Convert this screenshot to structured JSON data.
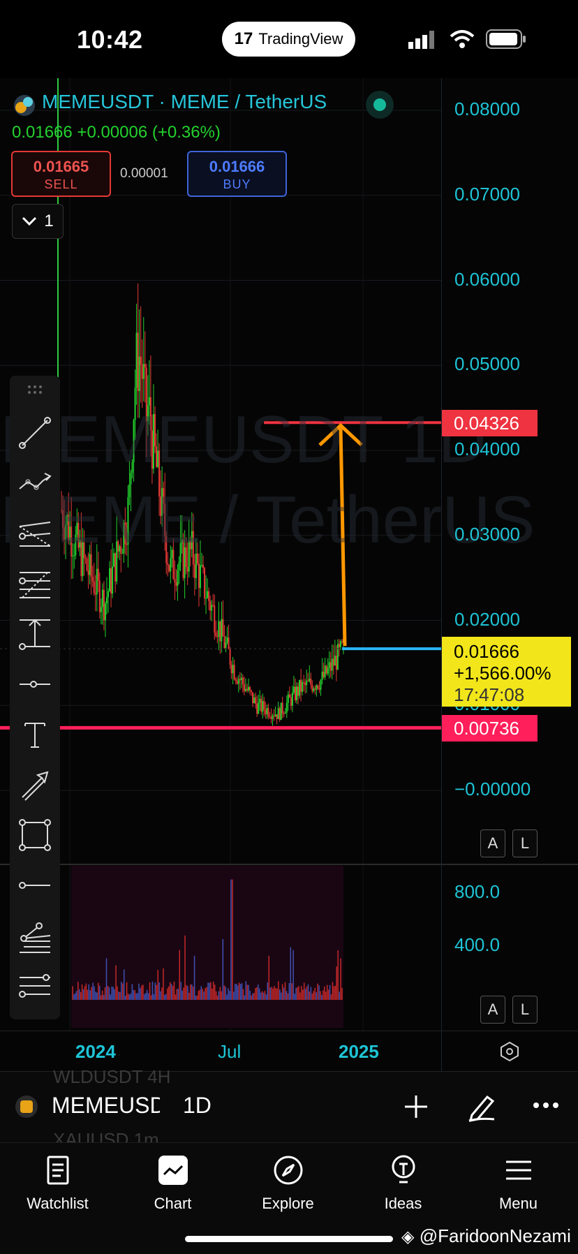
{
  "status_bar": {
    "time": "10:42",
    "app_pill": "TradingView",
    "logo_mark": "17"
  },
  "header": {
    "symbol_title": "MEMEUSDT · MEME / TetherUS",
    "price_change": "0.01666  +0.00006 (+0.36%)",
    "sell": {
      "value": "0.01665",
      "label": "SELL"
    },
    "spread": "0.00001",
    "buy": {
      "value": "0.01666",
      "label": "BUY"
    },
    "interval_count": "1"
  },
  "watermark_symbol": "MEMEUSDT 1D",
  "watermark_name": "MEME / TetherUS",
  "price_axis": [
    "0.08000",
    "0.07000",
    "0.06000",
    "0.05000",
    "0.04000",
    "0.03000",
    "0.02000",
    "0.01000",
    "−0.00000"
  ],
  "volume_axis": [
    "800.0",
    "400.0"
  ],
  "time_axis": [
    "2024",
    "Jul",
    "2025"
  ],
  "tags": {
    "target": "0.04326",
    "last_price": "0.01666",
    "last_change": "+1,566.00%",
    "countdown": "17:47:08",
    "support": "0.00736"
  },
  "al_buttons": {
    "a": "A",
    "l": "L"
  },
  "bottom_row": {
    "symbol": "MEMEUSD",
    "interval": "1D",
    "ghost_prev": "WLDUSDT   4H",
    "ghost_next": "XAUUSD   1m"
  },
  "tabs": [
    {
      "label": "Watchlist",
      "icon": "watchlist-icon"
    },
    {
      "label": "Chart",
      "icon": "chart-icon"
    },
    {
      "label": "Explore",
      "icon": "compass-icon"
    },
    {
      "label": "Ideas",
      "icon": "lightbulb-icon"
    },
    {
      "label": "Menu",
      "icon": "menu-icon"
    }
  ],
  "credit": "@FaridoonNezami",
  "colors": {
    "accent_cyan": "#26c6da",
    "up_green": "#23d12e",
    "down_red": "#e53935",
    "target_line": "#ef3340",
    "support_line": "#ff1f5a",
    "arrow_orange": "#ff9800",
    "last_price_bg": "#f2e61a"
  },
  "chart_data": {
    "type": "candlestick",
    "x": [
      "2023-11",
      "2023-12",
      "2024-01",
      "2024-02",
      "2024-03",
      "2024-04",
      "2024-05",
      "2024-06",
      "2024-07",
      "2024-08",
      "2024-09",
      "2024-10",
      "2024-11",
      "2024-12"
    ],
    "close": [
      0.033,
      0.027,
      0.022,
      0.032,
      0.045,
      0.026,
      0.028,
      0.021,
      0.014,
      0.01,
      0.009,
      0.012,
      0.013,
      0.01666
    ],
    "ylim": [
      0,
      0.085
    ],
    "last": 0.01666,
    "target": 0.04326,
    "support": 0.00736,
    "volume_ylim": [
      0,
      950
    ]
  }
}
